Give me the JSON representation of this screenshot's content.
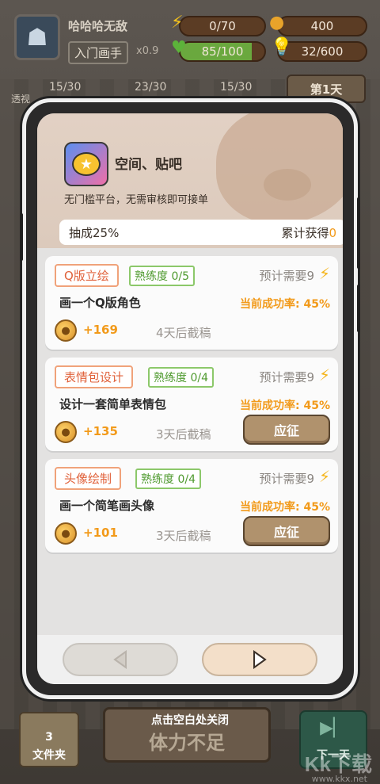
{
  "player": {
    "name": "哈哈哈无敌",
    "rank": "入门画手",
    "multiplier": "x0.9"
  },
  "stats": {
    "energy": "0/70",
    "coins": "400",
    "health": "85/100",
    "health_fraction": 0.85,
    "ideas": "32/600"
  },
  "tabs": [
    {
      "label": "透视",
      "value": "15/30"
    },
    {
      "label": "",
      "value": "23/30"
    },
    {
      "label": "",
      "value": "15/30"
    }
  ],
  "day": "第1天",
  "platform": {
    "name": "空间、贴吧",
    "description": "无门槛平台，无需审核即可接单",
    "commission_label": "抽成25%",
    "earned_label": "累计获得",
    "earned_value": "0"
  },
  "jobs": [
    {
      "type": "Q版立绘",
      "skill": "熟练度 0/5",
      "need": "预计需要9",
      "title": "画一个Q版角色",
      "rate": "当前成功率: 45%",
      "reward": "+169",
      "deadline": "4天后截稿",
      "apply": ""
    },
    {
      "type": "表情包设计",
      "skill": "熟练度 0/4",
      "need": "预计需要9",
      "title": "设计一套简单表情包",
      "rate": "当前成功率: 45%",
      "reward": "+135",
      "deadline": "3天后截稿",
      "apply": "应征"
    },
    {
      "type": "头像绘制",
      "skill": "熟练度 0/4",
      "need": "预计需要9",
      "title": "画一个简笔画头像",
      "rate": "当前成功率: 45%",
      "reward": "+101",
      "deadline": "3天后截稿",
      "apply": "应征"
    }
  ],
  "close_hint": "点击空白处关闭",
  "bottom": {
    "folder_count": "3",
    "folder_label": "文件夹",
    "energy_text": "体力不足",
    "next_day": "下一天"
  },
  "watermark": "Kk下载",
  "watermark_url": "www.kkx.net",
  "icons": {
    "energy": "lightning-icon",
    "coins": "coin-icon",
    "health": "heart-icon",
    "ideas": "lightbulb-icon"
  }
}
